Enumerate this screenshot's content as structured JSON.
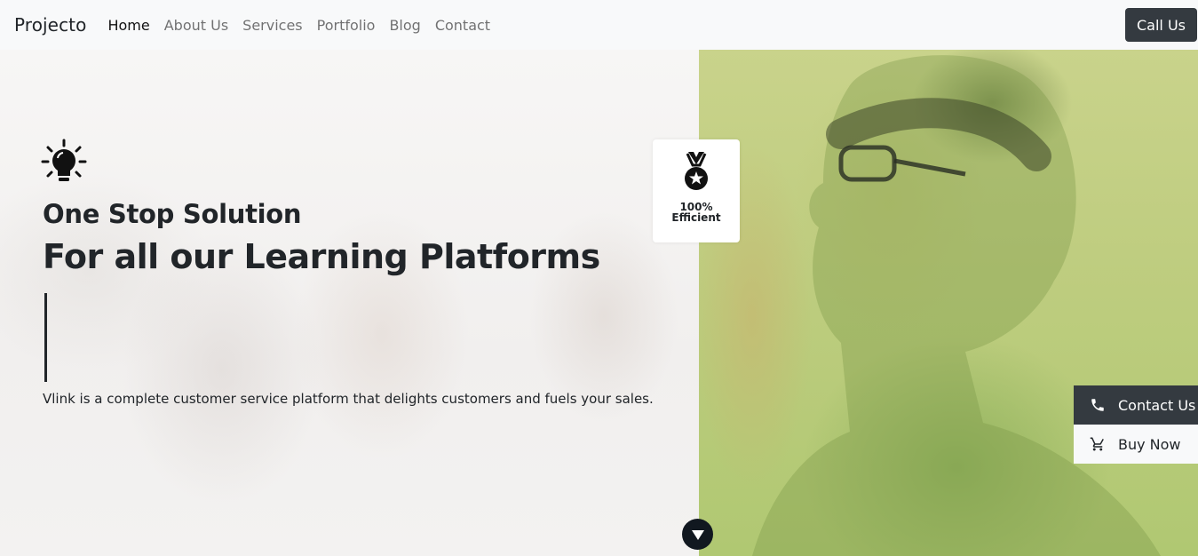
{
  "navbar": {
    "brand": "Projecto",
    "links": [
      {
        "label": "Home",
        "active": true
      },
      {
        "label": "About Us",
        "active": false
      },
      {
        "label": "Services",
        "active": false
      },
      {
        "label": "Portfolio",
        "active": false
      },
      {
        "label": "Blog",
        "active": false
      },
      {
        "label": "Contact",
        "active": false
      }
    ],
    "cta_label": "Call Us"
  },
  "hero": {
    "icon": "lightbulb-icon",
    "title_line1": "One Stop Solution",
    "title_line2": "For all our Learning Platforms",
    "description": "Vlink is a complete customer service platform that delights customers and fuels your sales.",
    "badge": {
      "icon": "medal-icon",
      "line1": "100%",
      "line2": "Efficient"
    },
    "scroll_icon": "chevron-down-icon"
  },
  "side_actions": {
    "contact": {
      "label": "Contact Us",
      "icon": "phone-icon"
    },
    "buy": {
      "label": "Buy Now",
      "icon": "cart-icon"
    }
  },
  "colors": {
    "navbar_bg": "#f8f9fa",
    "dark_button": "#343a40",
    "hero_image_tint": "#c4d07f",
    "text_dark": "#212529"
  }
}
